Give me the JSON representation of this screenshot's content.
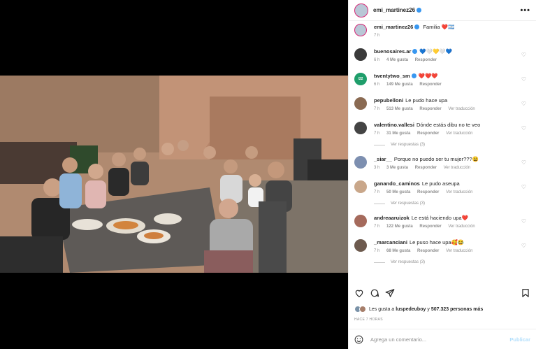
{
  "post": {
    "author": "emi_martinez26",
    "caption_user": "emi_martinez26",
    "caption_text": "Familia",
    "caption_emoji": "❤️🇦🇷",
    "caption_time": "7 h"
  },
  "comments": [
    {
      "user": "buenosaires.ar",
      "verified": true,
      "text": "💙🤍💛🤍💙",
      "time": "6 h",
      "likes": "4 Me gusta",
      "reply": "Responder",
      "translate": "",
      "replies": "",
      "avatar_color": "#3a3a3a"
    },
    {
      "user": "twentytwo_sm",
      "verified": true,
      "text": "❤️❤️❤️",
      "time": "6 h",
      "likes": "149 Me gusta",
      "reply": "Responder",
      "translate": "",
      "replies": "",
      "avatar_color": "#1f9e6b",
      "avatar_text": "/22"
    },
    {
      "user": "pepubelloni",
      "verified": false,
      "text": "Le pudo hace upa",
      "time": "7 h",
      "likes": "513 Me gusta",
      "reply": "Responder",
      "translate": "Ver traducción",
      "replies": "",
      "avatar_color": "#8a6a52"
    },
    {
      "user": "valentino.vallesi",
      "verified": false,
      "text": "Dónde estás dibu no te veo",
      "time": "7 h",
      "likes": "31 Me gusta",
      "reply": "Responder",
      "translate": "Ver traducción",
      "replies": "Ver respuestas (3)",
      "avatar_color": "#444444"
    },
    {
      "user": "_siar__",
      "verified": false,
      "text": "Porque no puedo ser tu mujer???😩",
      "time": "3 h",
      "likes": "3 Me gusta",
      "reply": "Responder",
      "translate": "Ver traducción",
      "replies": "",
      "avatar_color": "#7d8fb0"
    },
    {
      "user": "ganando_caminos",
      "verified": false,
      "text": "Le pudo aseupa",
      "time": "7 h",
      "likes": "50 Me gusta",
      "reply": "Responder",
      "translate": "Ver traducción",
      "replies": "Ver respuestas (3)",
      "avatar_color": "#c9a78a"
    },
    {
      "user": "andreaaruizok",
      "verified": false,
      "text": "Le está haciendo upa❤️",
      "time": "7 h",
      "likes": "122 Me gusta",
      "reply": "Responder",
      "translate": "Ver traducción",
      "replies": "",
      "avatar_color": "#a56a5c"
    },
    {
      "user": "_marcanciani",
      "verified": false,
      "text": "Le puso hace upa🥰😂",
      "time": "7 h",
      "likes": "68 Me gusta",
      "reply": "Responder",
      "translate": "Ver traducción",
      "replies": "Ver respuestas (3)",
      "avatar_color": "#6d5a4e"
    }
  ],
  "likes_bar": {
    "prefix": "Les gusta a",
    "user": "luspedeuboy",
    "middle": "y",
    "count": "507.323 personas más"
  },
  "time_ago": "HACE 7 HORAS",
  "comment_box": {
    "placeholder": "Agrega un comentario...",
    "publish_label": "Publicar"
  },
  "icons": {
    "more": "more-horizontal-icon",
    "like": "heart-icon",
    "comment": "comment-icon",
    "share": "paper-plane-icon",
    "save": "bookmark-icon",
    "emoji": "emoji-icon",
    "tag": "user-tag-icon"
  },
  "colors": {
    "accent": "#3897f0",
    "story_ring": "#d62976",
    "publish_disabled": "#b2dffc",
    "meta_gray": "#8e8e8e",
    "text": "#262626"
  }
}
